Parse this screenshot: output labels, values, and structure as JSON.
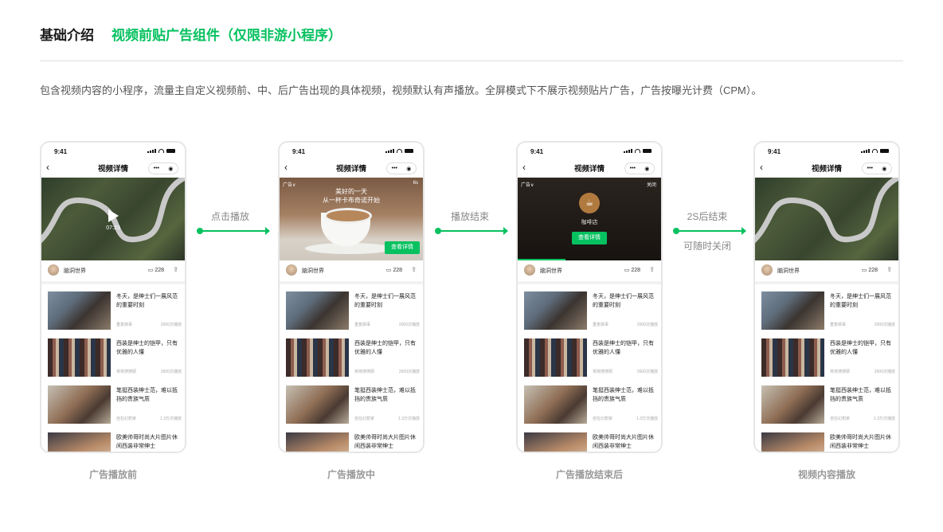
{
  "header": {
    "section": "基础介绍",
    "title": "视频前贴广告组件（仅限非游小程序）"
  },
  "description": "包含视频内容的小程序，流量主自定义视频前、中、后广告出现的具体视频，视频默认有声播放。全屏模式下不展示视频贴片广告，广告按曝光计费（CPM）。",
  "phone_common": {
    "time": "9:41",
    "nav_title": "视频详情",
    "back_glyph": "‹",
    "more_glyph": "•••",
    "target_glyph": "◉",
    "author": "脑洞世界",
    "comments": "228",
    "comment_glyph": "▭",
    "share_glyph": "⇪"
  },
  "video": {
    "duration": "07:23"
  },
  "ad_playing": {
    "tag": "广告∨",
    "timer": "6s",
    "slogan_line1": "美好的一天",
    "slogan_line2": "从一杯卡布奇诺开始",
    "cta": "查看详情"
  },
  "ad_end": {
    "tag": "广告∨",
    "close": "关闭",
    "cafe_icon": "☕",
    "cafe_name": "咖啡店",
    "cta": "查看详情"
  },
  "list": [
    {
      "title": "冬天，是绅士们一展风范的重要时刻",
      "source": "重复搞事",
      "views": "2000次播放"
    },
    {
      "title": "西装是绅士的铠甲，只有优雅的人懂",
      "source": "将将搜搜顾",
      "views": "2600次播放"
    },
    {
      "title": "笔挺西装绅士范，难以抵挡的贵族气质",
      "source": "自在幻想家",
      "views": "1.3万次播放"
    },
    {
      "title": "欧美帅哥时尚大片图片休闲西装非常绅士",
      "source": "",
      "views": ""
    }
  ],
  "arrows": [
    {
      "label": "点击播放",
      "sub": ""
    },
    {
      "label": "播放结束",
      "sub": ""
    },
    {
      "label": "2S后结束",
      "sub": "可随时关闭"
    }
  ],
  "captions": [
    "广告播放前",
    "广告播放中",
    "广告播放结束后",
    "视频内容播放"
  ],
  "colors": {
    "accent": "#07c160",
    "title_dark": "#1a1a1a",
    "caption": "#999999"
  }
}
